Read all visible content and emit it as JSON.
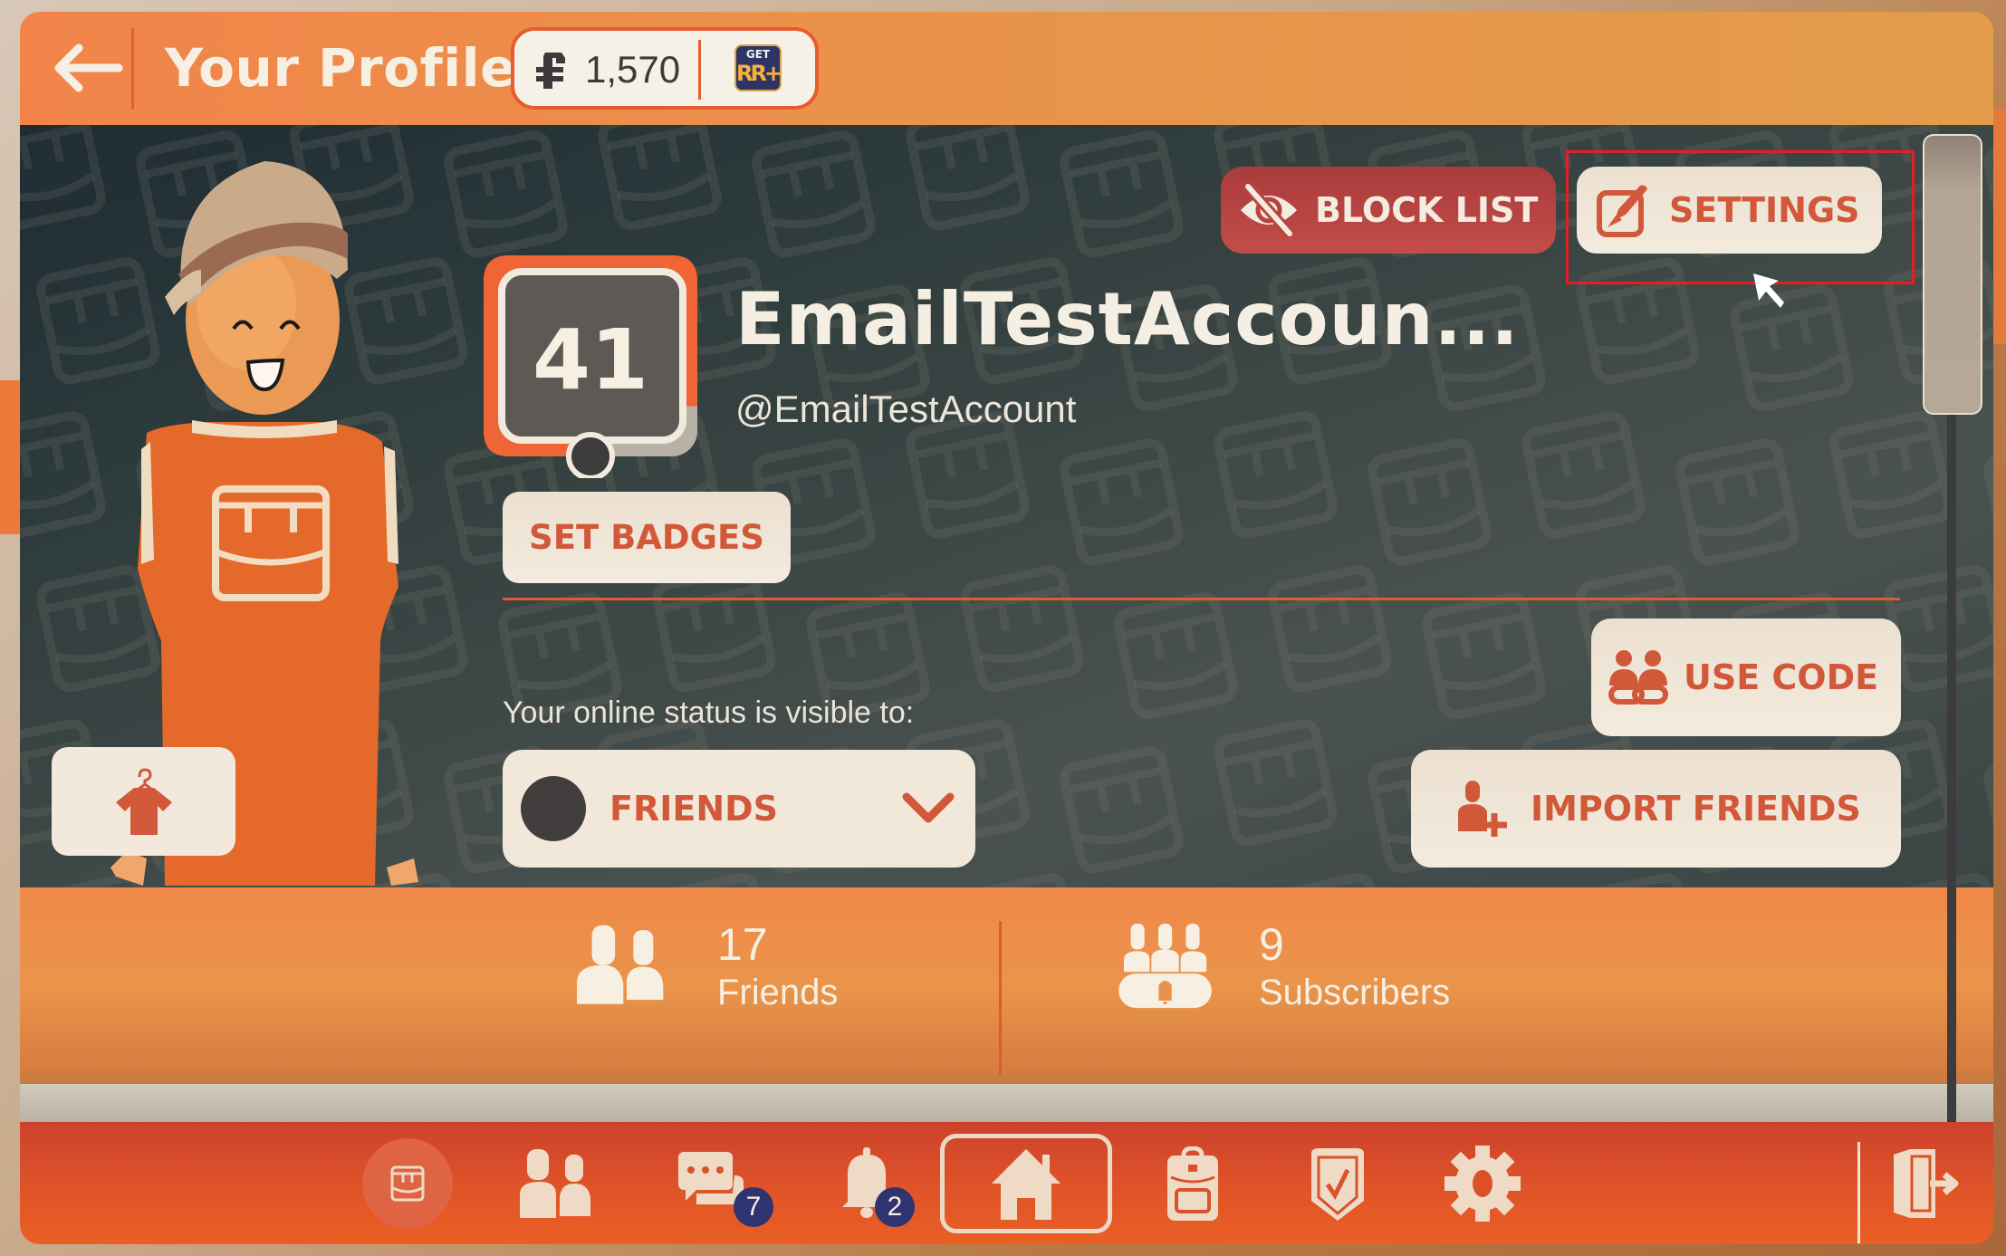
{
  "header": {
    "title": "Your Profile",
    "back_label": "Back",
    "currency": {
      "icon": "tokens-icon",
      "amount": "1,570",
      "get_more_top": "GET",
      "get_more_bottom": "RR+"
    }
  },
  "actions": {
    "block_list": "BLOCK LIST",
    "settings": "SETTINGS",
    "set_badges": "SET BADGES",
    "use_code": "USE CODE",
    "import_friends": "IMPORT FRIENDS"
  },
  "profile": {
    "level": "41",
    "level_progress": 0.75,
    "display_name": "EmailTestAccoun...",
    "handle": "@EmailTestAccount"
  },
  "status": {
    "label": "Your online status is visible to:",
    "selected": "FRIENDS"
  },
  "stats": {
    "friends": {
      "count": "17",
      "label": "Friends"
    },
    "subscribers": {
      "count": "9",
      "label": "Subscribers"
    }
  },
  "nav": {
    "items": [
      {
        "name": "profile",
        "icon": "rec-room-logo-icon"
      },
      {
        "name": "friends",
        "icon": "people-icon"
      },
      {
        "name": "messages",
        "icon": "chat-icon",
        "badge": "7"
      },
      {
        "name": "notifications",
        "icon": "bell-icon",
        "badge": "2"
      },
      {
        "name": "home",
        "icon": "home-icon",
        "selected": true
      },
      {
        "name": "backpack",
        "icon": "backpack-icon"
      },
      {
        "name": "challenges",
        "icon": "shield-check-icon"
      },
      {
        "name": "settings",
        "icon": "gear-icon"
      },
      {
        "name": "exit",
        "icon": "exit-door-icon"
      }
    ]
  },
  "colors": {
    "accent": "#D2583A",
    "header": "#E29C4A",
    "danger": "#C34C48",
    "badge": "#2E3470",
    "cream": "#F2E8DA"
  }
}
